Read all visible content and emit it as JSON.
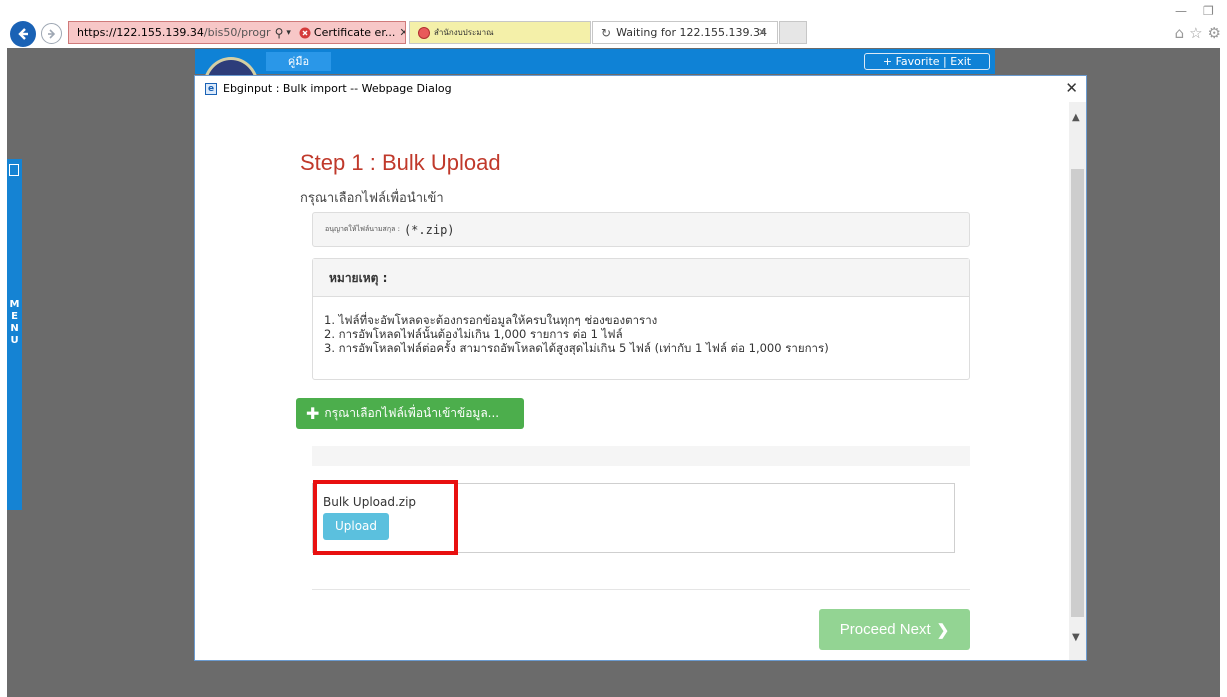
{
  "browser": {
    "url_scheme_host": "https://122.155.139.34",
    "url_path": "/bis50/progr",
    "certificate_label": "Certificate er...",
    "tabs": [
      {
        "label": "สำนักงบประมาณ"
      },
      {
        "label": "Waiting for 122.155.139.34"
      }
    ]
  },
  "page": {
    "menu_label": "คู่มือ",
    "favorite_exit": "+ Favorite | Exit",
    "side_menu_letters": [
      "M",
      "E",
      "N",
      "U"
    ]
  },
  "dialog": {
    "title": "Ebginput : Bulk import -- Webpage Dialog",
    "close_glyph": "✕",
    "step_title": "Step 1 : Bulk Upload",
    "subtitle": "กรุณาเลือกไฟล์เพื่อนำเข้า",
    "allowed_label": "อนุญาตให้ไฟล์นามสกุล :",
    "allowed_value": "(*.zip)",
    "note_title": "หมายเหตุ :",
    "notes": [
      "1. ไฟล์ที่จะอัพโหลดจะต้องกรอกข้อมูลให้ครบในทุกๆ ช่องของตาราง",
      "2. การอัพโหลดไฟล์นั้นต้องไม่เกิน 1,000 รายการ ต่อ 1 ไฟล์",
      "3. การอัพโหลดไฟล์ต่อครั้ง สามารถอัพโหลดได้สูงสุดไม่เกิน 5 ไฟล์ (เท่ากับ 1 ไฟล์ ต่อ 1,000 รายการ)"
    ],
    "choose_button": "กรุณาเลือกไฟล์เพื่อนำเข้าข้อมูล...",
    "file_name": "Bulk Upload.zip",
    "upload_button": "Upload",
    "proceed_button": "Proceed Next"
  },
  "colors": {
    "step_title": "#c0392b",
    "choose_button": "#4cae4c",
    "upload_button": "#5bc0de",
    "proceed_button": "#93d493",
    "highlight": "#e81010",
    "page_header": "#0f82d6"
  }
}
